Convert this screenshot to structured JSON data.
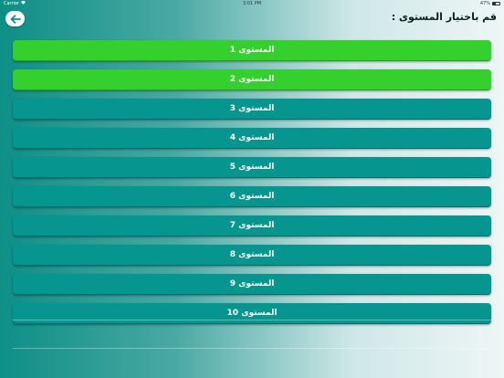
{
  "status_bar": {
    "carrier": "Carrier",
    "time": "3:01 PM",
    "battery": "47%",
    "battery_level": 0.47
  },
  "header": {
    "back_icon": "arrow-left-icon",
    "title": "قم باختيار المستوى :"
  },
  "levels": [
    {
      "label": "المستوى 1",
      "state": "unlocked"
    },
    {
      "label": "المستوى 2",
      "state": "unlocked"
    },
    {
      "label": "المستوى 3",
      "state": "locked"
    },
    {
      "label": "المستوى 4",
      "state": "locked"
    },
    {
      "label": "المستوى 5",
      "state": "locked"
    },
    {
      "label": "المستوى 6",
      "state": "locked"
    },
    {
      "label": "المستوى 7",
      "state": "locked"
    },
    {
      "label": "المستوى 8",
      "state": "locked"
    },
    {
      "label": "المستوى 9",
      "state": "locked"
    },
    {
      "label": "المستوى 10",
      "state": "locked"
    }
  ],
  "colors": {
    "unlocked": "#35d02e",
    "locked": "#07968f",
    "back_arrow": "#0d8f86"
  }
}
